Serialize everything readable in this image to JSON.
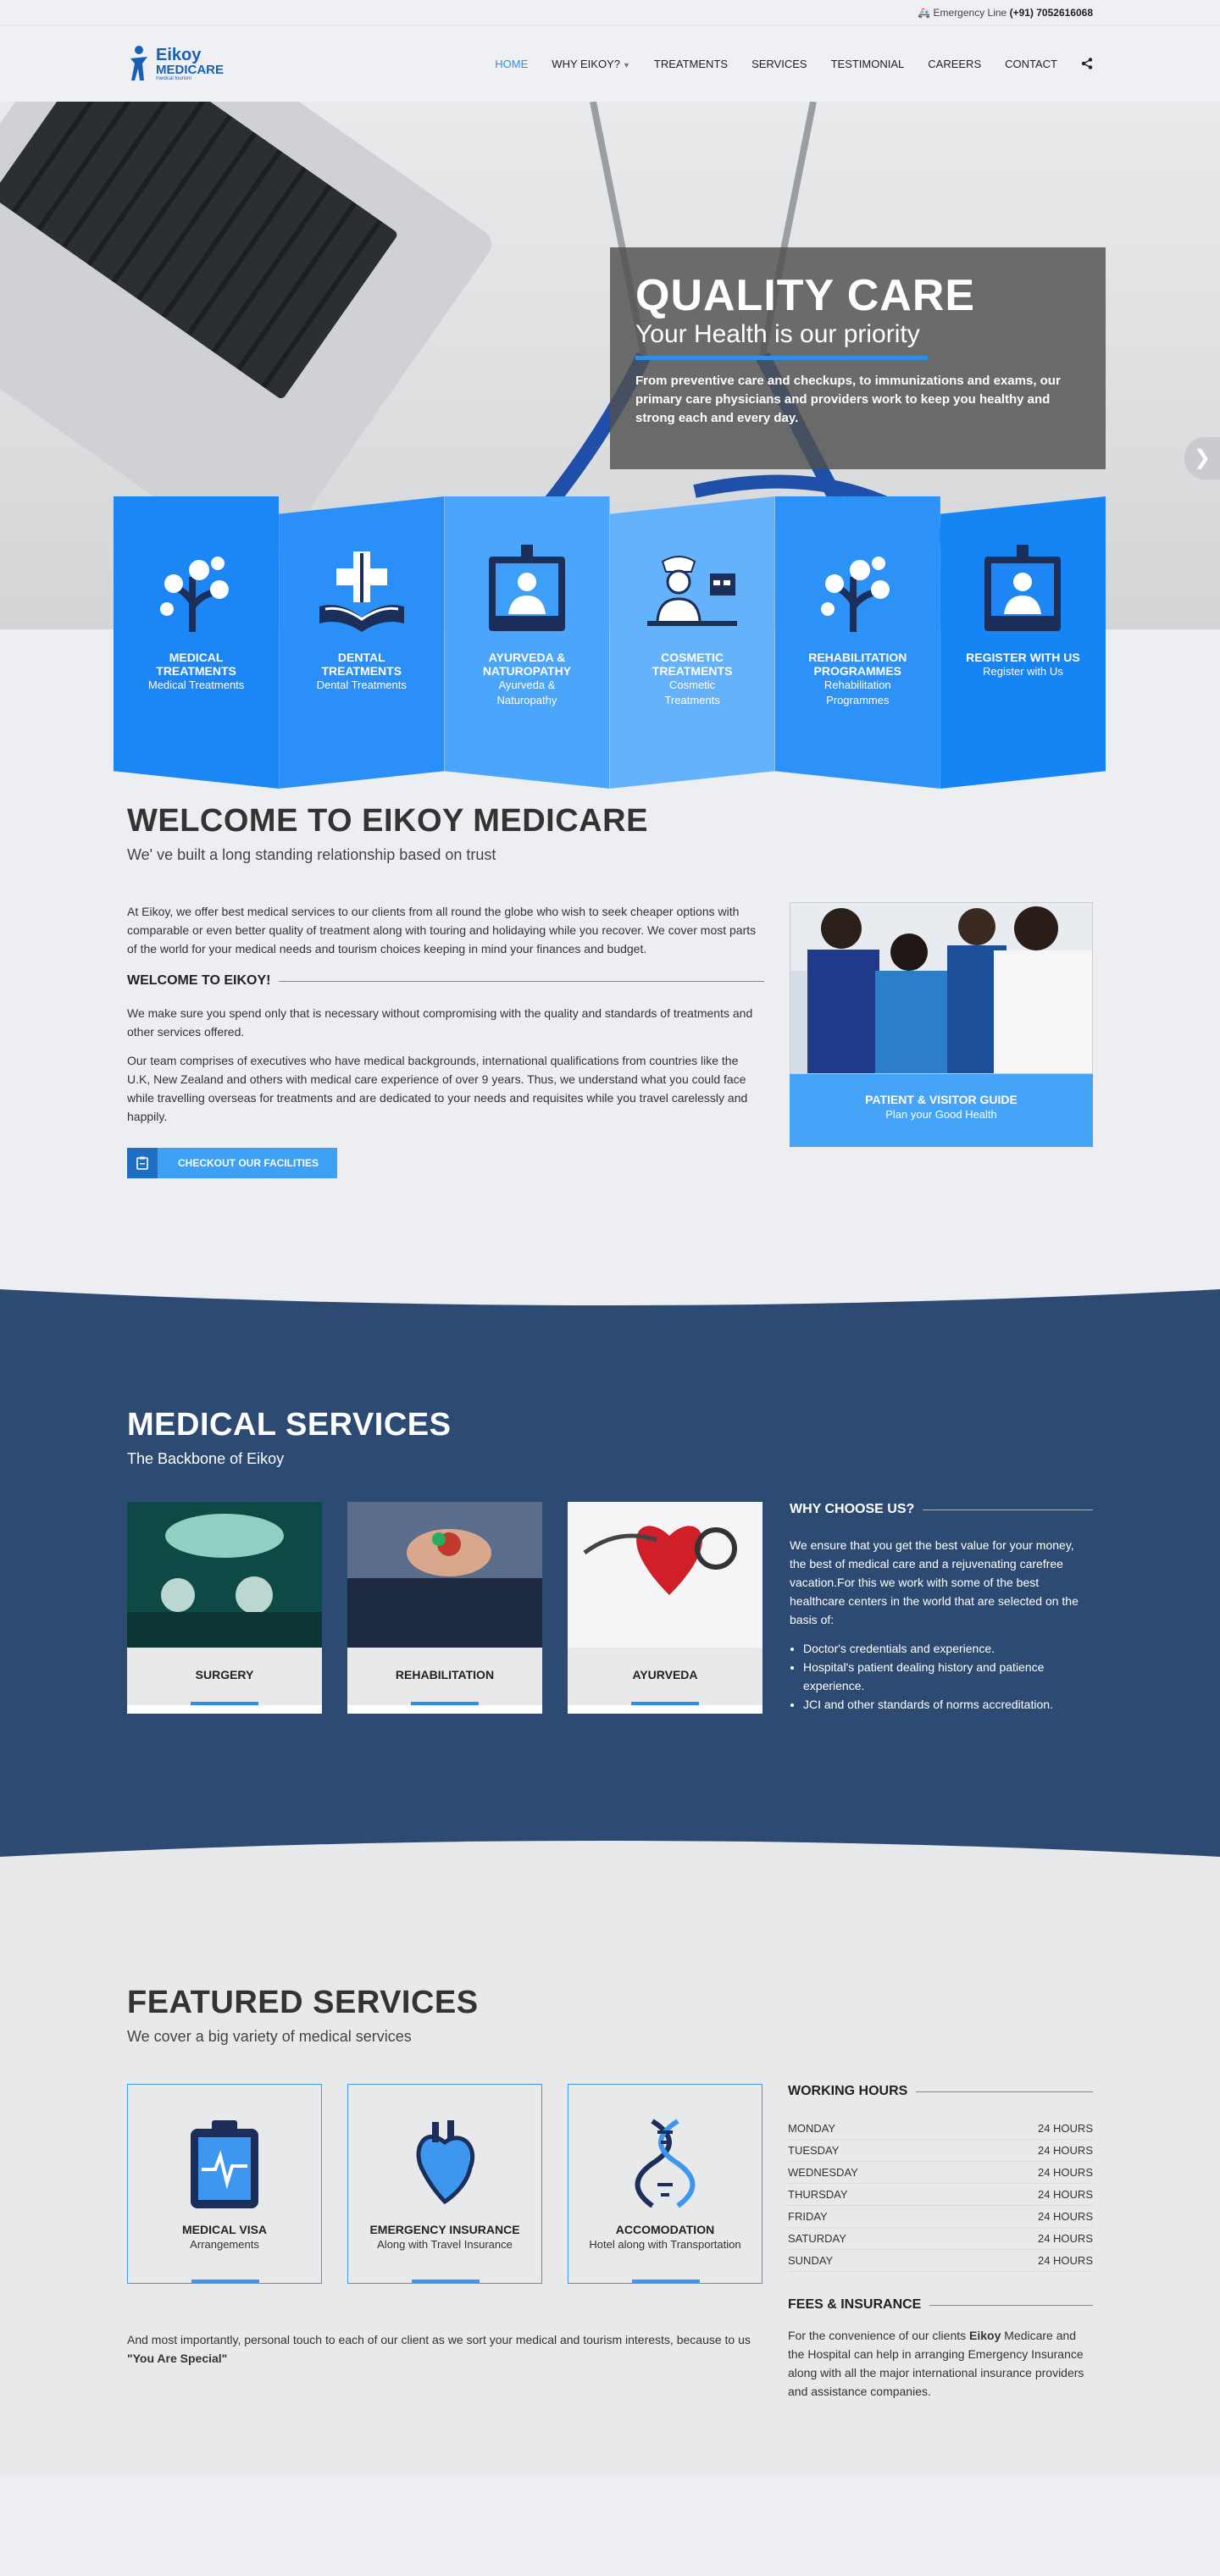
{
  "topbar": {
    "label": "Emergency Line",
    "phone": "(+91) 7052616068"
  },
  "logo": {
    "line1": "Eikoy",
    "line2": "MEDICARE",
    "tag": "medical tourism"
  },
  "nav": [
    {
      "label": "HOME"
    },
    {
      "label": "WHY EIKOY?"
    },
    {
      "label": "TREATMENTS"
    },
    {
      "label": "SERVICES"
    },
    {
      "label": "TESTIMONIAL"
    },
    {
      "label": "CAREERS"
    },
    {
      "label": "CONTACT"
    }
  ],
  "hero": {
    "title": "QUALITY CARE",
    "subtitle": "Your Health is our priority",
    "description": "From preventive care and checkups, to immunizations and exams, our primary care physicians and providers work to keep you healthy and strong each and every day."
  },
  "tiles": [
    {
      "title": "MEDICAL TREATMENTS",
      "sub": "Medical Treatments",
      "color": "#1d86f5"
    },
    {
      "title": "DENTAL TREATMENTS",
      "sub": "Dental Treatments",
      "color": "#2a8ff7"
    },
    {
      "title": "AYURVEDA & NATUROPATHY",
      "sub": "Ayurveda & Naturopathy",
      "color": "#4aa5fb"
    },
    {
      "title": "COSMETIC TREATMENTS",
      "sub": "Cosmetic Treatments",
      "color": "#63b2fb"
    },
    {
      "title": "REHABILITATION PROGRAMMES",
      "sub": "Rehabilitation Programmes",
      "color": "#2d92f8"
    },
    {
      "title": "REGISTER WITH US",
      "sub": "Register with Us",
      "color": "#1584f5"
    }
  ],
  "welcome": {
    "title": "WELCOME TO EIKOY MEDICARE",
    "subtitle": "We' ve built a long standing relationship based on trust",
    "p1": "At Eikoy, we offer best medical services to our clients from all round the globe who wish to seek cheaper options with comparable or even better quality of treatment along with touring and holidaying while you recover. We cover most parts of the world for your medical needs and tourism choices keeping in mind your finances and budget.",
    "subhead": "WELCOME TO EIKOY!",
    "p2": "We make sure you spend only that is necessary without compromising with the quality and standards of treatments and other services offered.",
    "p3": "Our team comprises of executives who have medical backgrounds, international qualifications from countries like the U.K, New Zealand and others with medical care experience of over 9 years. Thus, we understand what you could face while travelling overseas for treatments and are dedicated to your needs and requisites while you travel carelessly and happily.",
    "button": "CHECKOUT OUR FACILITIES",
    "card_title": "PATIENT & VISITOR GUIDE",
    "card_sub": "Plan your Good Health"
  },
  "services": {
    "title": "MEDICAL SERVICES",
    "subtitle": "The Backbone of Eikoy",
    "cards": [
      {
        "label": "SURGERY"
      },
      {
        "label": "REHABILITATION"
      },
      {
        "label": "AYURVEDA"
      }
    ],
    "why_title": "WHY CHOOSE US?",
    "why_text": "We ensure that you get the best value for your money, the best of medical care and a rejuvenating carefree vacation.For this we work with some of the best healthcare centers in the world that are selected on the basis of:",
    "why_list": [
      "Doctor's credentials and experience.",
      "Hospital's patient dealing history and patience experience.",
      "JCI and other standards of norms accreditation."
    ]
  },
  "featured": {
    "title": "FEATURED SERVICES",
    "subtitle": "We cover a big variety of medical services",
    "cards": [
      {
        "title": "MEDICAL VISA",
        "sub": "Arrangements"
      },
      {
        "title": "EMERGENCY INSURANCE",
        "sub": "Along with Travel Insurance"
      },
      {
        "title": "ACCOMODATION",
        "sub": "Hotel along with Transportation"
      }
    ],
    "note_pre": "And most importantly, personal touch to each of our client as we sort your medical and tourism interests, because to us ",
    "note_bold": "\"You Are Special\""
  },
  "hours": {
    "title": "WORKING HOURS",
    "rows": [
      {
        "day": "MONDAY",
        "time": "24 HOURS"
      },
      {
        "day": "TUESDAY",
        "time": "24 HOURS"
      },
      {
        "day": "WEDNESDAY",
        "time": "24 HOURS"
      },
      {
        "day": "THURSDAY",
        "time": "24 HOURS"
      },
      {
        "day": "FRIDAY",
        "time": "24 HOURS"
      },
      {
        "day": "SATURDAY",
        "time": "24 HOURS"
      },
      {
        "day": "SUNDAY",
        "time": "24 HOURS"
      }
    ]
  },
  "fees": {
    "title": "FEES & INSURANCE",
    "pre": "For the convenience of our clients ",
    "bold": "Eikoy",
    "post": " Medicare and the Hospital can help in arranging Emergency Insurance along with all the major international insurance providers and assistance companies."
  }
}
